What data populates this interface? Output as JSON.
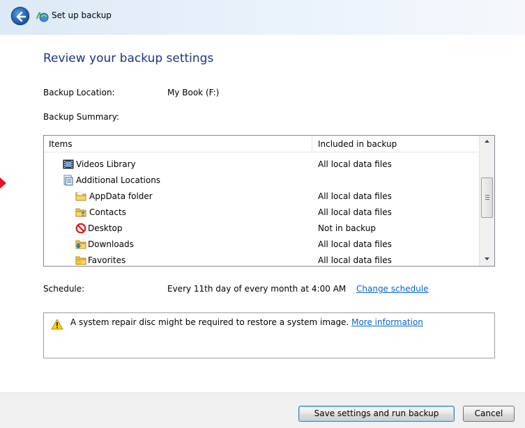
{
  "window": {
    "title": "Set up backup"
  },
  "heading": "Review your backup settings",
  "location": {
    "label": "Backup Location:",
    "value": "My Book (F:)"
  },
  "summary": {
    "label": "Backup Summary:"
  },
  "table": {
    "columns": [
      "Items",
      "Included in backup"
    ],
    "rows": [
      {
        "name": "Videos Library",
        "value": "All local data files",
        "icon": "video-library-icon",
        "indent": 1
      },
      {
        "name": "Additional Locations",
        "value": "",
        "icon": "additional-locations-icon",
        "indent": 1
      },
      {
        "name": "AppData folder",
        "value": "All local data files",
        "icon": "folder-icon",
        "indent": 2
      },
      {
        "name": "Contacts",
        "value": "All local data files",
        "icon": "contacts-folder-icon",
        "indent": 2
      },
      {
        "name": "Desktop",
        "value": "Not in backup",
        "icon": "not-included-icon",
        "indent": 2
      },
      {
        "name": "Downloads",
        "value": "All local data files",
        "icon": "downloads-folder-icon",
        "indent": 2
      },
      {
        "name": "Favorites",
        "value": "All local data files",
        "icon": "favorites-folder-icon",
        "indent": 2
      }
    ]
  },
  "schedule": {
    "label": "Schedule:",
    "value": "Every 11th day of every month at 4:00 AM",
    "link": "Change schedule"
  },
  "info": {
    "text": "A system repair disc might be required to restore a system image.",
    "link": "More information"
  },
  "buttons": {
    "save": "Save settings and run backup",
    "cancel": "Cancel"
  },
  "colors": {
    "heading": "#1e3287",
    "link": "#0066cc",
    "marker": "#e81123"
  }
}
